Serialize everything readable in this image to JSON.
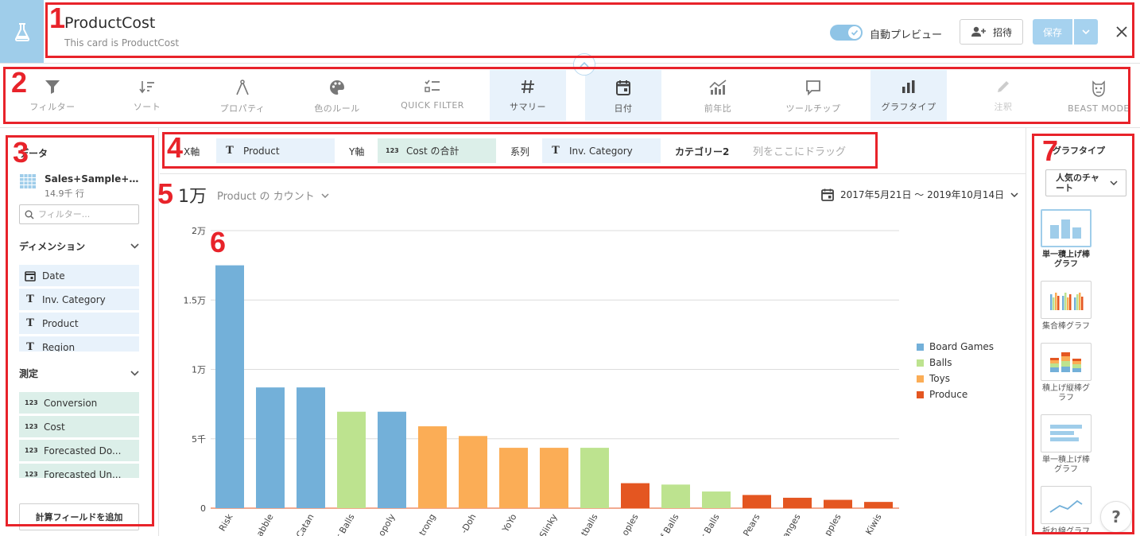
{
  "header": {
    "title": "ProductCost",
    "description": "This card is ProductCost",
    "auto_preview_label": "自動プレビュー",
    "invite_label": "招待",
    "save_label": "保存"
  },
  "toolbar": [
    {
      "name": "tool-filter",
      "label": "フィルター",
      "icon": "filter-icon",
      "state": "normal"
    },
    {
      "name": "tool-sort",
      "label": "ソート",
      "icon": "sort-icon",
      "state": "normal"
    },
    {
      "name": "tool-properties",
      "label": "プロパティ",
      "icon": "compass-icon",
      "state": "normal"
    },
    {
      "name": "tool-color-rules",
      "label": "色のルール",
      "icon": "palette-icon",
      "state": "normal"
    },
    {
      "name": "tool-quick-filter",
      "label": "QUICK FILTER",
      "icon": "checklist-icon",
      "state": "normal"
    },
    {
      "name": "tool-summary",
      "label": "サマリー",
      "icon": "hash-icon",
      "state": "active"
    },
    {
      "name": "tool-date",
      "label": "日付",
      "icon": "calendar-icon",
      "state": "active"
    },
    {
      "name": "tool-yoy",
      "label": "前年比",
      "icon": "trend-chart-icon",
      "state": "normal"
    },
    {
      "name": "tool-tooltip",
      "label": "ツールチップ",
      "icon": "speech-bubble-icon",
      "state": "normal"
    },
    {
      "name": "tool-chart-type",
      "label": "グラフタイプ",
      "icon": "bar-chart-icon",
      "state": "active"
    },
    {
      "name": "tool-annotation",
      "label": "注釈",
      "icon": "pencil-icon",
      "state": "disabled"
    },
    {
      "name": "tool-beast-mode",
      "label": "BEAST MODE",
      "icon": "beast-icon",
      "state": "normal"
    }
  ],
  "data_panel": {
    "title": "データ",
    "dataset_name": "Sales+Sample+Dat...",
    "dataset_rows": "14.9千 行",
    "filter_placeholder": "フィルター...",
    "dimensions_label": "ディメンション",
    "dimensions": [
      {
        "label": "Date",
        "type": "date"
      },
      {
        "label": "Inv. Category",
        "type": "text"
      },
      {
        "label": "Product",
        "type": "text"
      },
      {
        "label": "Region",
        "type": "text"
      }
    ],
    "measures_label": "測定",
    "measures": [
      {
        "label": "Conversion"
      },
      {
        "label": "Cost"
      },
      {
        "label": "Forecasted Do..."
      },
      {
        "label": "Forecasted Un..."
      }
    ],
    "calc_button": "計算フィールドを追加"
  },
  "shelves": {
    "x_label": "X軸",
    "x_value": "Product",
    "y_label": "Y軸",
    "y_value": "Cost の合計",
    "series_label": "系列",
    "series_value": "Inv. Category",
    "cat2_label": "カテゴリー2",
    "drop_hint": "列をここにドラッグ"
  },
  "summary": {
    "value": "1万",
    "label": "Product の カウント",
    "date_range": "2017年5月21日 〜 2019年10月14日"
  },
  "chart_data": {
    "type": "bar",
    "categories": [
      "Risk",
      "abble",
      "Catan",
      "r Balls",
      "opoly",
      "trong",
      "-Doh",
      "YoYo",
      "Slinky",
      "tballs",
      "oples",
      "f Balls",
      "r Balls",
      "Pears",
      "anges",
      "pples",
      "Kiwis"
    ],
    "values": [
      17500,
      8700,
      8700,
      6950,
      6950,
      5900,
      5200,
      4350,
      4350,
      4350,
      1800,
      1700,
      1200,
      950,
      750,
      600,
      450
    ],
    "series_of_bar": [
      "Board Games",
      "Board Games",
      "Board Games",
      "Balls",
      "Board Games",
      "Toys",
      "Toys",
      "Toys",
      "Toys",
      "Balls",
      "Produce",
      "Balls",
      "Balls",
      "Produce",
      "Produce",
      "Produce",
      "Produce"
    ],
    "series": [
      {
        "name": "Board Games",
        "color": "#73b0d9"
      },
      {
        "name": "Balls",
        "color": "#bde38f"
      },
      {
        "name": "Toys",
        "color": "#fbad56"
      },
      {
        "name": "Produce",
        "color": "#e45621"
      }
    ],
    "ylim": [
      0,
      20000
    ],
    "yticks": [
      0,
      5000,
      10000,
      15000,
      20000
    ],
    "ytick_labels": [
      "0",
      "5千",
      "1万",
      "1.5万",
      "2万"
    ],
    "grid": true,
    "legend": "right"
  },
  "right_panel": {
    "title": "グラフタイプ",
    "select_value": "人気のチャート",
    "chart_types": [
      {
        "name": "single-stacked-bar",
        "label": "単一積上げ棒グラフ",
        "selected": true
      },
      {
        "name": "grouped-bar",
        "label": "集合棒グラフ",
        "selected": false
      },
      {
        "name": "stacked-bar",
        "label": "積上げ縦棒グラフ",
        "selected": false
      },
      {
        "name": "single-stacked-hbar",
        "label": "単一積上げ棒グラフ",
        "selected": false
      },
      {
        "name": "line-chart",
        "label": "折れ線グラフ",
        "selected": false
      }
    ]
  },
  "help_label": "?",
  "annotations": [
    "1",
    "2",
    "3",
    "4",
    "5",
    "6",
    "7"
  ]
}
